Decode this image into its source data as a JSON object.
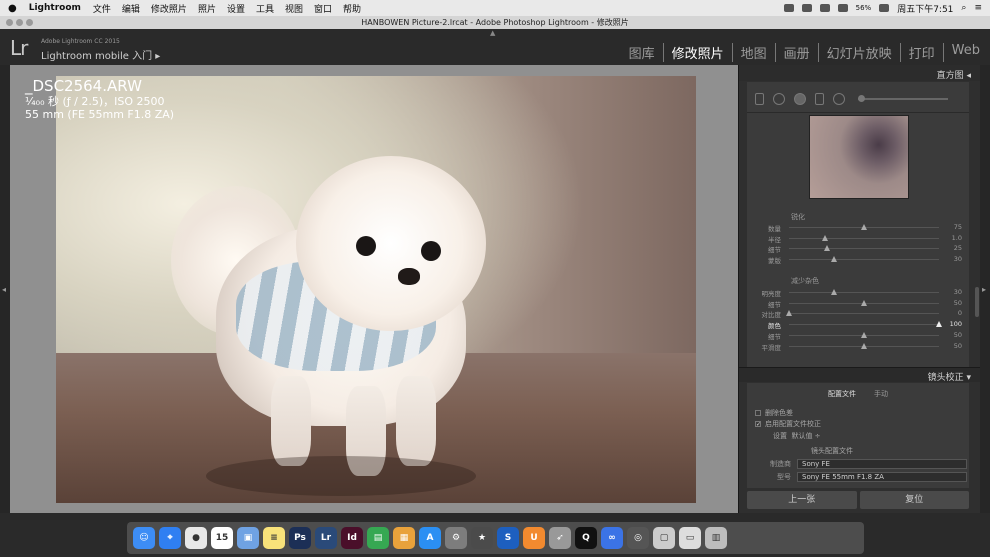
{
  "menubar": {
    "apple": "",
    "app": "Lightroom",
    "items": [
      "文件",
      "编辑",
      "修改照片",
      "照片",
      "设置",
      "工具",
      "视图",
      "窗口",
      "帮助"
    ],
    "battery": "56%",
    "clock": "周五下午7:51"
  },
  "titlebar": {
    "title": "HANBOWEN Picture-2.lrcat - Adobe Photoshop Lightroom - 修改照片"
  },
  "header": {
    "logo": "Lr",
    "version": "Adobe Lightroom CC 2015",
    "mobile": "Lightroom mobile 入门 ▸",
    "modules": [
      "图库",
      "修改照片",
      "地图",
      "画册",
      "幻灯片放映",
      "打印",
      "Web"
    ],
    "active_module": "修改照片"
  },
  "photo_info": {
    "filename": "_DSC2564.ARW",
    "exposure": "¹⁄₄₀₀ 秒 (ƒ / 2.5)，ISO 2500",
    "lens": "55 mm (FE 55mm F1.8 ZA)"
  },
  "right_panel": {
    "histogram_title": "直方图 ◂",
    "sharpening": {
      "title": "锐化",
      "rows": [
        {
          "label": "数量",
          "value": "75",
          "pct": 0.5
        },
        {
          "label": "半径",
          "value": "1.0",
          "pct": 0.24
        },
        {
          "label": "细节",
          "value": "25",
          "pct": 0.25
        },
        {
          "label": "蒙版",
          "value": "30",
          "pct": 0.3
        }
      ]
    },
    "noise": {
      "title": "减少杂色",
      "rows": [
        {
          "label": "明亮度",
          "value": "30",
          "pct": 0.3,
          "hl": false
        },
        {
          "label": "细节",
          "value": "50",
          "pct": 0.5,
          "hl": false
        },
        {
          "label": "对比度",
          "value": "0",
          "pct": 0.0,
          "hl": false
        },
        {
          "label": "颜色",
          "value": "100",
          "pct": 1.0,
          "hl": true
        },
        {
          "label": "细节",
          "value": "50",
          "pct": 0.5,
          "hl": false
        },
        {
          "label": "平滑度",
          "value": "50",
          "pct": 0.5,
          "hl": false
        }
      ]
    },
    "lens": {
      "title": "镜头校正 ▾",
      "tabs": [
        "配置文件",
        "手动"
      ],
      "active_tab": "配置文件",
      "check_remove_ca": "删除色差",
      "check_enable_profile": "启用配置文件校正",
      "setup_label": "设置",
      "setup_value": "默认值 ÷",
      "profile_section": "镜头配置文件",
      "make_label": "制造商",
      "make_value": "Sony FE",
      "model_label": "型号",
      "model_value": "Sony FE 55mm F1.8 ZA"
    },
    "buttons": {
      "prev": "上一张",
      "reset": "复位"
    }
  },
  "dock_icons": [
    "finder-icon",
    "safari-icon",
    "chrome-icon",
    "calendar-icon",
    "preview-icon",
    "notes-icon",
    "photoshop-icon",
    "lightroom-icon",
    "indesign-icon",
    "numbers-icon",
    "keynote-icon",
    "appstore-icon",
    "sysprefs-icon",
    "imovie-icon",
    "s-icon",
    "uc-icon",
    "launchpad-icon",
    "qq-icon",
    "baidu-icon",
    "capture-icon",
    "screenshot-icon",
    "finder2-icon",
    "trash-icon"
  ],
  "dock_colors": [
    "#3d8df5",
    "#2f7ff2",
    "#e8e8e8",
    "#ffffff",
    "#6fa2e3",
    "#f8e27a",
    "#1c2f56",
    "#2a4a79",
    "#4a0f2a",
    "#36a852",
    "#e9a23b",
    "#2b8ff3",
    "#7d7d7d",
    "#4b4b4b",
    "#1d5fbf",
    "#f28a2f",
    "#999999",
    "#111111",
    "#3b73e6",
    "#555555",
    "#cccccc",
    "#dddddd",
    "#bdbdbd"
  ],
  "dock_glyphs": [
    "☺",
    "⌖",
    "●",
    "15",
    "▣",
    "≡",
    "Ps",
    "Lr",
    "Id",
    "▤",
    "▦",
    "A",
    "⚙",
    "★",
    "S",
    "U",
    "➶",
    "Q",
    "∞",
    "◎",
    "▢",
    "▭",
    "▥"
  ]
}
